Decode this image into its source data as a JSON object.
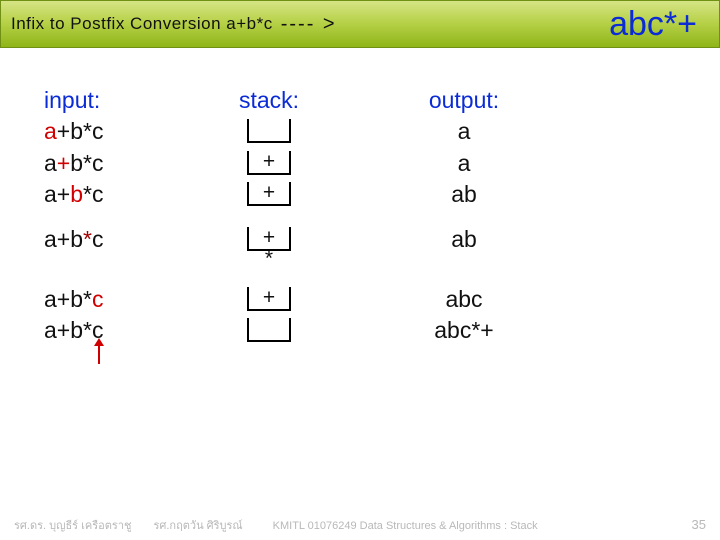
{
  "title": {
    "left": "Infix to Postfix Conversion  a+b*c",
    "arrow": "---- >",
    "result": "abc*+"
  },
  "headers": {
    "input": "input:",
    "stack": "stack:",
    "output": "output:"
  },
  "steps": [
    {
      "input_plain": "a+b*c",
      "input_hl": "a",
      "hl_index": 0,
      "hl_class": "highlight-red",
      "stack": [],
      "output": "a"
    },
    {
      "input_plain": "a+b*c",
      "input_hl": "+",
      "hl_index": 1,
      "hl_class": "highlight-red",
      "stack": [
        "+"
      ],
      "output": "a"
    },
    {
      "input_plain": "a+b*c",
      "input_hl": "b",
      "hl_index": 2,
      "hl_class": "highlight-red",
      "stack": [
        "+"
      ],
      "output": "ab"
    },
    {
      "input_plain": "a+b*c",
      "input_hl": "*",
      "hl_index": 3,
      "hl_class": "highlight-darkred",
      "stack": [
        "+",
        "*"
      ],
      "output": "ab",
      "gap_before": true
    },
    {
      "input_plain": "a+b*c",
      "input_hl": "c",
      "hl_index": 4,
      "hl_class": "highlight-red",
      "stack": [
        "+"
      ],
      "output": "abc",
      "gap_before": true
    },
    {
      "input_plain": "a+b*c",
      "input_hl": "",
      "hl_index": -1,
      "hl_class": "",
      "stack": [],
      "output": "abc*+",
      "arrow_after": true
    }
  ],
  "chart_data": {
    "type": "table",
    "title": "Infix to Postfix Conversion a+b*c ----> abc*+",
    "columns": [
      "input",
      "stack",
      "output"
    ],
    "rows": [
      [
        "a+b*c (scan a)",
        "",
        "a"
      ],
      [
        "a+b*c (scan +)",
        "+",
        "a"
      ],
      [
        "a+b*c (scan b)",
        "+",
        "ab"
      ],
      [
        "a+b*c (scan *)",
        "+ *",
        "ab"
      ],
      [
        "a+b*c (scan c)",
        "+",
        "abc"
      ],
      [
        "a+b*c (end)",
        "",
        "abc*+"
      ]
    ]
  },
  "footer": {
    "names1": "รศ.ดร. บุญธีร์     เครือตราชู",
    "names2": "รศ.กฤตวัน   ศิริบูรณ์",
    "course": "KMITL   01076249 Data Structures & Algorithms : Stack",
    "page": "35"
  }
}
